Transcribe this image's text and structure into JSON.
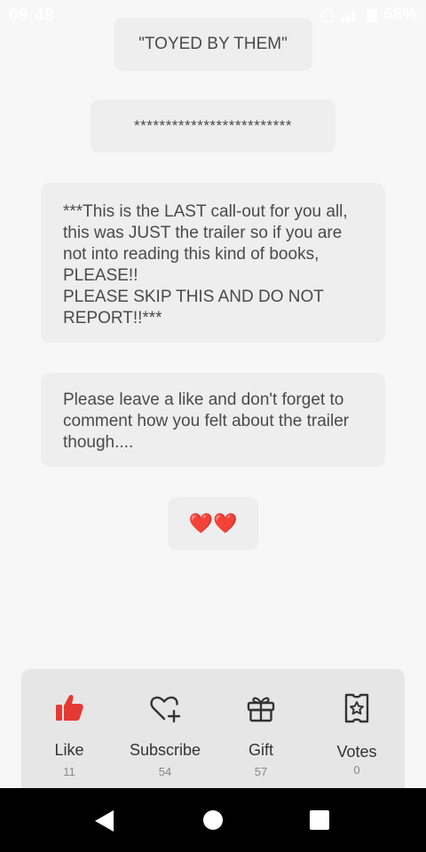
{
  "status_bar": {
    "time": "09:49",
    "battery": "68%"
  },
  "messages": [
    "\"TOYED BY THEM\"",
    "*************************",
    "***This is the LAST call-out for you all, this was JUST the trailer so if you are not into reading this kind of books, PLEASE!!\nPLEASE SKIP THIS AND DO NOT REPORT!!***",
    "Please leave a like and don't forget to comment how you felt about the trailer though....",
    "❤️❤️"
  ],
  "actions": {
    "like": {
      "label": "Like",
      "count": "11",
      "icon": "thumbs-up-icon",
      "color": "#e53935"
    },
    "subscribe": {
      "label": "Subscribe",
      "count": "54",
      "icon": "heart-plus-icon"
    },
    "gift": {
      "label": "Gift",
      "count": "57",
      "icon": "gift-icon"
    },
    "votes": {
      "label": "Votes",
      "count": "0",
      "icon": "ticket-star-icon"
    }
  }
}
